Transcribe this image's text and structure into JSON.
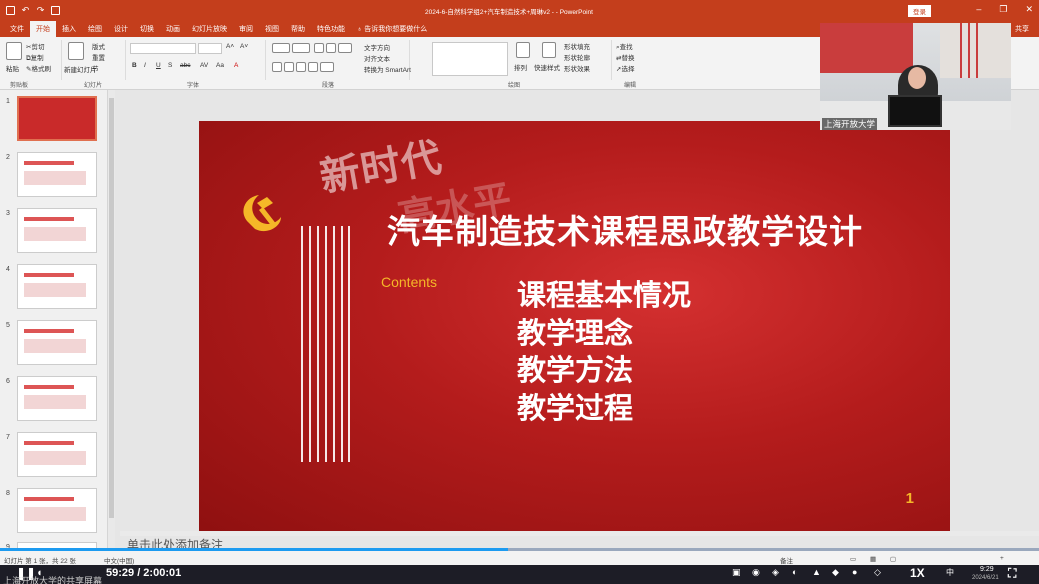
{
  "window": {
    "doc_title": "2024-6-自然科学组2+汽车制造技术+周琳v2 - -  PowerPoint",
    "login_label": "登录",
    "win_icons": [
      "minimize-icon",
      "restore-icon",
      "close-icon"
    ]
  },
  "ribbon_tabs": [
    "文件",
    "开始",
    "插入",
    "绘图",
    "设计",
    "切换",
    "动画",
    "幻灯片放映",
    "审阅",
    "视图",
    "帮助",
    "特色功能"
  ],
  "active_tab": "开始",
  "tell_me": "告诉我你想要做什么",
  "share_label": "共享",
  "ribbon": {
    "clipboard": {
      "paste": "粘贴",
      "cut": "剪切",
      "copy": "复制",
      "format_painter": "格式刷",
      "label": "剪贴板"
    },
    "slides": {
      "new_slide": "新建幻灯片",
      "layout": "版式",
      "reset": "重置",
      "section": "节",
      "label": "幻灯片"
    },
    "font": {
      "label": "字体"
    },
    "paragraph": {
      "text_direction": "文字方向",
      "align_text": "对齐文本",
      "smartart": "转换为 SmartArt",
      "label": "段落"
    },
    "drawing": {
      "arrange": "排列",
      "quick_styles": "快速样式",
      "fill": "形状填充",
      "outline": "形状轮廓",
      "effects": "形状效果",
      "label": "绘图"
    },
    "editing": {
      "find": "查找",
      "replace": "替换",
      "select": "选择",
      "label": "编辑"
    }
  },
  "thumbnails": [
    {
      "num": "1",
      "selected": true
    },
    {
      "num": "2",
      "selected": false
    },
    {
      "num": "3",
      "selected": false
    },
    {
      "num": "4",
      "selected": false
    },
    {
      "num": "5",
      "selected": false
    },
    {
      "num": "6",
      "selected": false
    },
    {
      "num": "7",
      "selected": false
    },
    {
      "num": "8",
      "selected": false
    },
    {
      "num": "9",
      "selected": false
    }
  ],
  "slide": {
    "watermark": "新时代",
    "watermark2": "高水平",
    "title": "汽车制造技术课程思政教学设计",
    "contents_label": "Contents",
    "items": [
      "课程基本情况",
      "教学理念",
      "教学方法",
      "教学过程"
    ],
    "page_number": "1"
  },
  "notes_placeholder": "单击此处添加备注",
  "status": {
    "slide_info": "幻灯片 第 1 张，共 22 张",
    "language": "中文(中国)",
    "notes": "备注",
    "zoom": "+"
  },
  "player": {
    "playback_progress": 0.489,
    "time": "59:29 / 2:00:01",
    "speed": "1X",
    "caption": "上海开放大学的共享屏幕",
    "clock_time": "9:29",
    "clock_date": "2024/6/21",
    "ime": "中"
  },
  "pip": {
    "brand": "上海开放大学"
  }
}
